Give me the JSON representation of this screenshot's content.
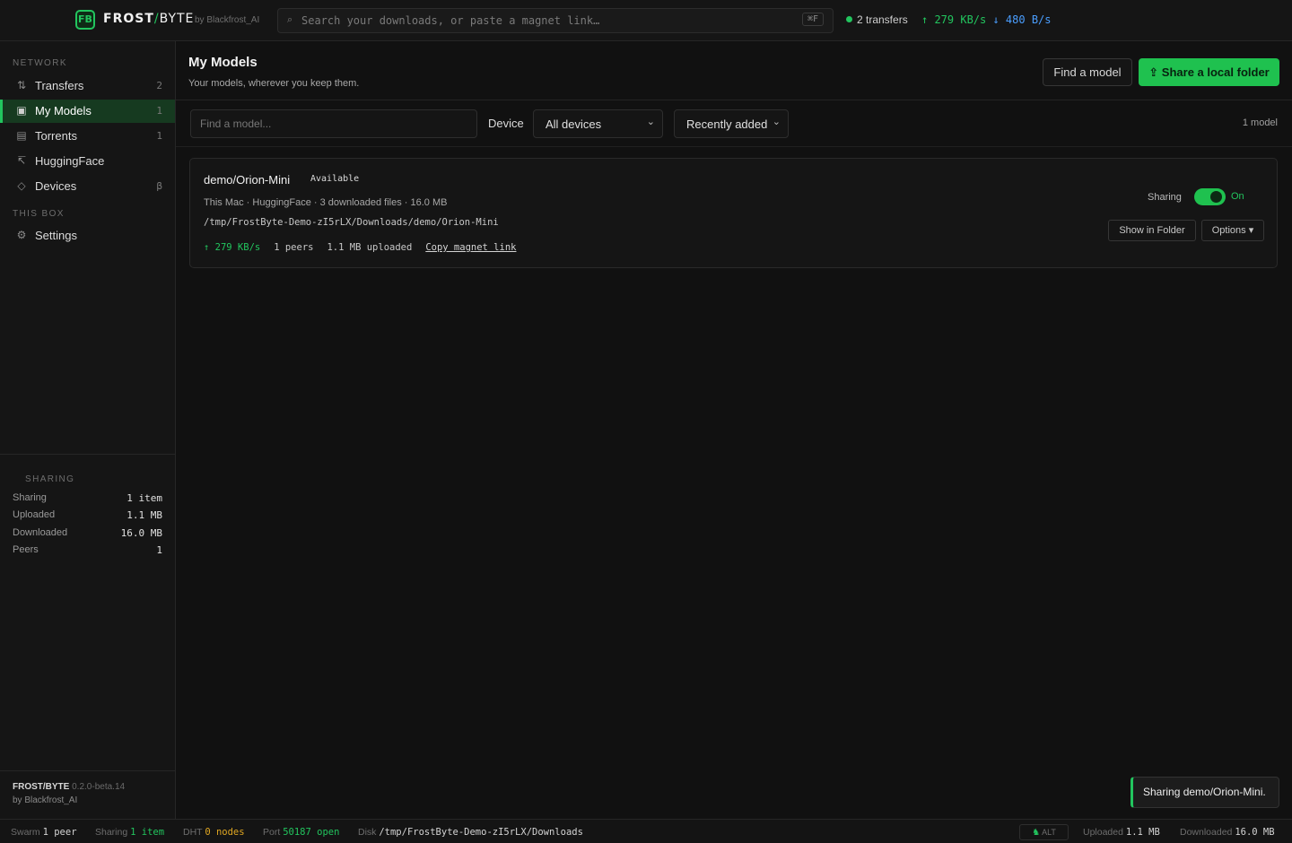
{
  "app": {
    "brand_prefix": "FROST",
    "brand_slash": "/",
    "brand_suffix": "BYTE",
    "by": "by Blackfrost_AI",
    "accent_color": "#22c55e"
  },
  "topbar": {
    "search_placeholder": "Search your downloads, or paste a magnet link…",
    "shortcut": "⌘F",
    "transfers": "2 transfers",
    "upload_rate": "↑ 279 KB/s",
    "download_rate": "↓ 480 B/s"
  },
  "sidebar": {
    "network_label": "NETWORK",
    "items": [
      {
        "label": "Transfers",
        "count": "2",
        "icon": "transfer-arrows-icon"
      },
      {
        "label": "My Models",
        "count": "1",
        "icon": "cube-icon"
      },
      {
        "label": "Torrents",
        "count": "1",
        "icon": "list-icon"
      },
      {
        "label": "HuggingFace",
        "count": "",
        "icon": "arrow-up-left-icon"
      },
      {
        "label": "Devices",
        "count": "β",
        "icon": "diamond-icon"
      }
    ],
    "thisbox_label": "THIS BOX",
    "settings_label": "Settings",
    "sharing_label": "SHARING",
    "stats": [
      {
        "key": "Sharing",
        "value": "1 item"
      },
      {
        "key": "Uploaded",
        "value": "1.1 MB"
      },
      {
        "key": "Downloaded",
        "value": "16.0 MB"
      },
      {
        "key": "Peers",
        "value": "1"
      }
    ],
    "footer_brand": "FROST/BYTE",
    "footer_version": "0.2.0-beta.14",
    "footer_by": "by Blackfrost_AI"
  },
  "main": {
    "title": "My Models",
    "subtitle": "Your models, wherever you keep them.",
    "find_model_label": "Find a model",
    "share_folder_label": "Share a local folder",
    "filter_placeholder": "Find a model...",
    "device_label": "Device",
    "device_value": "All devices",
    "sort_value": "Recently added",
    "count_text": "1 model"
  },
  "card": {
    "name": "demo/Orion-Mini",
    "badge": "Available",
    "meta": "This Mac · HuggingFace · 3 downloaded files · 16.0 MB",
    "path": "/tmp/FrostByte-Demo-zI5rLX/Downloads/demo/Orion-Mini",
    "rate": "↑ 279 KB/s",
    "peers": "1 peers",
    "uploaded": "1.1 MB uploaded",
    "magnet": "Copy magnet link",
    "sharing_label": "Sharing",
    "toggle_state": "On",
    "show_folder": "Show in Folder",
    "options": "Options ▾"
  },
  "toast": {
    "text": "Sharing demo/Orion-Mini."
  },
  "statusbar": {
    "swarm_label": "Swarm",
    "swarm_value": "1 peer",
    "sharing_label": "Sharing",
    "sharing_value": "1 item",
    "dht_label": "DHT",
    "dht_value": "0 nodes",
    "port_label": "Port",
    "port_value": "50187 open",
    "disk_label": "Disk",
    "disk_value": "/tmp/FrostByte-Demo-zI5rLX/Downloads",
    "alt_label": "ALT",
    "uploaded_label": "Uploaded",
    "uploaded_value": "1.1 MB",
    "downloaded_label": "Downloaded",
    "downloaded_value": "16.0 MB"
  }
}
